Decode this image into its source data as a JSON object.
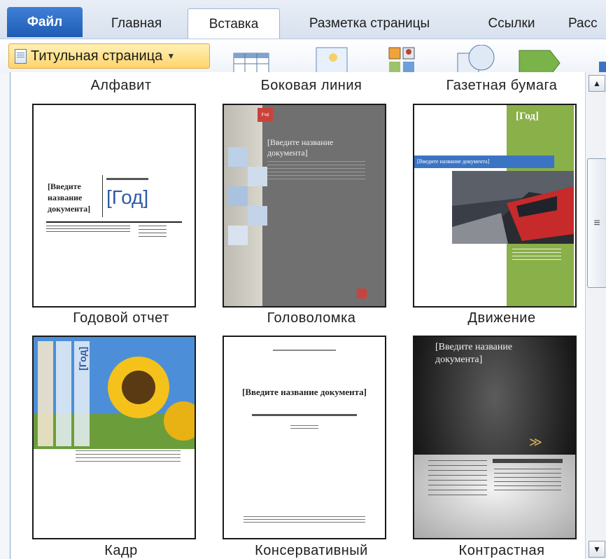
{
  "tabs": {
    "file": "Файл",
    "home": "Главная",
    "insert": "Вставка",
    "layout": "Разметка страницы",
    "references": "Ссылки",
    "mailings_partial": "Расс"
  },
  "ribbon": {
    "cover_page_button": "Титульная страница"
  },
  "gallery": {
    "row1_titles": [
      "Алфавит",
      "Боковая линия",
      "Газетная бумага"
    ],
    "row2_titles": [
      "Годовой отчет",
      "Головоломка",
      "Движение"
    ],
    "row3_titles": [
      "Кадр",
      "Консервативный",
      "Контрастная"
    ],
    "thumb_texts": {
      "godovoy_title": "[Введите название документа]",
      "godovoy_year": "[Год]",
      "golovolomka_title": "[Введите название документа]",
      "golovolomka_year": "[Год]",
      "dvizhenie_year": "[Год]",
      "dvizhenie_title": "[Введите название документа]",
      "kadr_year": "[Год]",
      "konservativny_title": "[Введите название документа]",
      "kontrastnaya_title": "[Введите название документа]"
    }
  },
  "colors": {
    "file_tab": "#2a68c0",
    "cover_button": "#ffd46a",
    "green_accent": "#8ab04a",
    "blue_band": "#3c74c4"
  }
}
